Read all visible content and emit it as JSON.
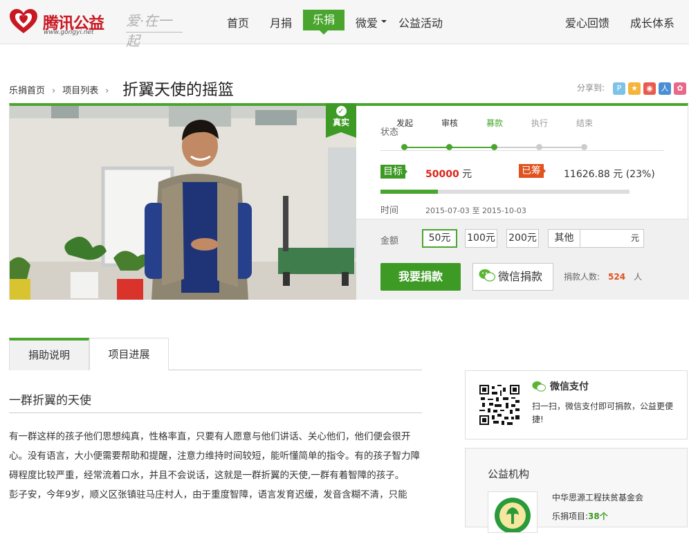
{
  "brand": {
    "name": "腾讯公益",
    "domain": "www.gongyi.net",
    "slogan": "爱·在一起"
  },
  "nav": {
    "home": "首页",
    "monthly": "月捐",
    "lejuan": "乐捐",
    "weiai": "微爱",
    "activity": "公益活动",
    "feedback": "爱心回馈",
    "growth": "成长体系"
  },
  "breadcrumb": {
    "home": "乐捐首页",
    "list": "项目列表",
    "title": "折翼天使的摇篮"
  },
  "share": {
    "label": "分享到:"
  },
  "badge": {
    "label": "真实"
  },
  "status": {
    "label": "状态",
    "steps": [
      "发起",
      "审核",
      "募款",
      "执行",
      "结束"
    ],
    "current_step": 3
  },
  "goal": {
    "tag": "目标",
    "amount": "50000",
    "unit": "元"
  },
  "raised": {
    "tag": "已筹",
    "amount": "11626.88 元",
    "percent": "(23%)",
    "progress": 0.23
  },
  "time": {
    "label": "时间",
    "start": "2015-07-03",
    "sep": "至",
    "end": "2015-10-03"
  },
  "donate": {
    "amount_label": "金额",
    "options": [
      "50元",
      "100元",
      "200元",
      "其他"
    ],
    "other_unit": "元",
    "button": "我要捐款",
    "wechat_button": "微信捐款",
    "donor_label": "捐款人数:",
    "donor_count": "524",
    "donor_unit": "人"
  },
  "tabs": [
    "捐助说明",
    "项目进展"
  ],
  "section": {
    "title": "一群折翼的天使",
    "paragraphs": [
      "有一群这样的孩子他们思想纯真，性格率直，只要有人愿意与他们讲话、关心他们，他们便会很开心。没有语言，大小便需要帮助和提醒，注意力维持时间较短，能听懂简单的指令。有的孩子智力障碍程度比较严重，经常流着口水，并且不会说话，这就是一群折翼的天使,一群有着智障的孩子。",
      "彭子安，今年9岁，顺义区张镇驻马庄村人，由于重度智障，语言发育迟缓，发音含糊不清，只能"
    ]
  },
  "wxpay": {
    "title": "微信支付",
    "desc": "扫一扫，微信支付即可捐款，公益更便捷!"
  },
  "org": {
    "heading": "公益机构",
    "name": "中华思源工程扶贫基金会",
    "projects_label": "乐捐项目:",
    "projects_count": "38个"
  },
  "colors": {
    "green": "#4aa52e",
    "red": "#c81923",
    "orange": "#e0521e"
  }
}
